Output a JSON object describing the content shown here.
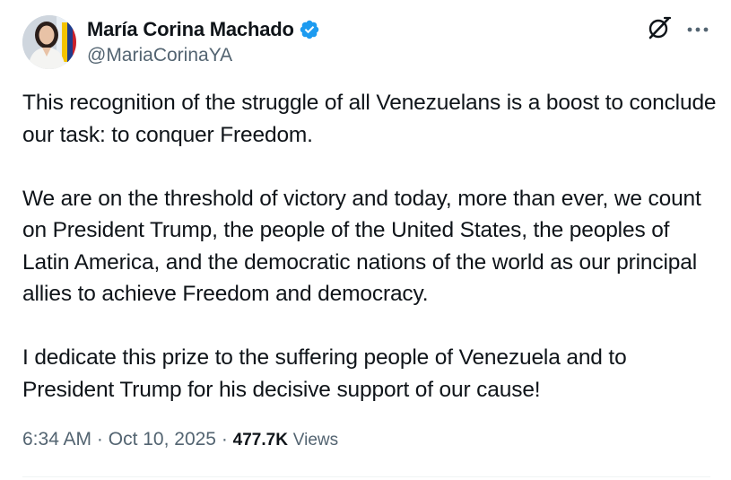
{
  "author": {
    "display_name": "María Corina Machado",
    "handle": "@MariaCorinaYA",
    "verified": true
  },
  "icons": {
    "verified": "verified-badge-icon",
    "grok": "grok-icon",
    "more": "more-options-icon"
  },
  "colors": {
    "verified_blue": "#1d9bf0",
    "text_primary": "#0f1419",
    "text_secondary": "#536471"
  },
  "tweet": {
    "paragraphs": [
      "This recognition of the struggle of all Venezuelans is a boost to conclude our task: to conquer Freedom.",
      "We are on the threshold of victory and today, more than ever, we count on President Trump, the people of the United States, the peoples of Latin America, and the democratic nations of the world as our principal allies to achieve Freedom and democracy.",
      "I dedicate this prize to the suffering people of Venezuela and to President Trump for his decisive support of our cause!"
    ],
    "time": "6:34 AM",
    "date": "Oct 10, 2025",
    "views_count": "477.7K",
    "views_label": "Views"
  }
}
